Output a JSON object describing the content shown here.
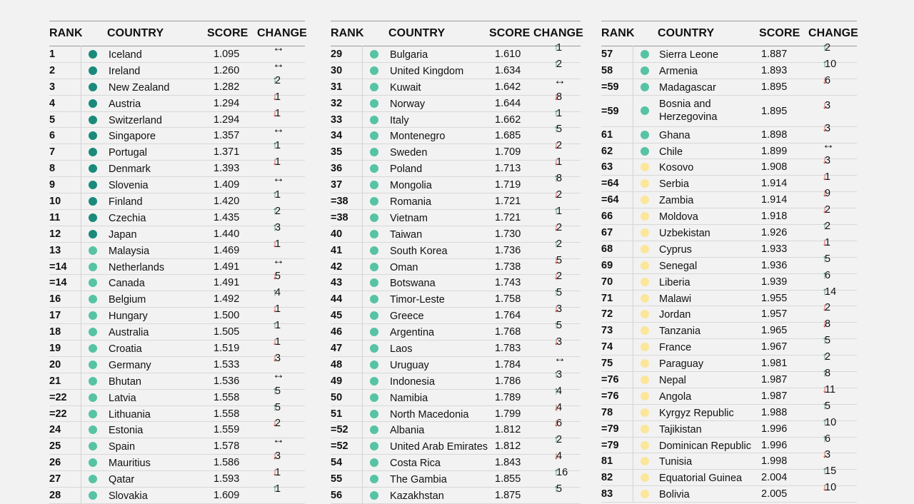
{
  "headers": {
    "rank": "RANK",
    "country": "COUNTRY",
    "score": "SCORE",
    "change": "CHANGE"
  },
  "colors": {
    "dark_teal": "#1a8a7a",
    "mid_teal": "#56c3a4",
    "light_yellow": "#fbe69a",
    "up": "#2e7d4f",
    "down": "#c62d1f"
  },
  "columns": [
    [
      {
        "rank": "1",
        "country": "Iceland",
        "score": "1.095",
        "dir": "flat",
        "change": "",
        "dot": "dark_teal"
      },
      {
        "rank": "2",
        "country": "Ireland",
        "score": "1.260",
        "dir": "flat",
        "change": "",
        "dot": "dark_teal"
      },
      {
        "rank": "3",
        "country": "New Zealand",
        "score": "1.282",
        "dir": "up",
        "change": "2",
        "dot": "dark_teal"
      },
      {
        "rank": "4",
        "country": "Austria",
        "score": "1.294",
        "dir": "down",
        "change": "1",
        "dot": "dark_teal"
      },
      {
        "rank": "5",
        "country": "Switzerland",
        "score": "1.294",
        "dir": "down",
        "change": "1",
        "dot": "dark_teal"
      },
      {
        "rank": "6",
        "country": "Singapore",
        "score": "1.357",
        "dir": "flat",
        "change": "",
        "dot": "dark_teal"
      },
      {
        "rank": "7",
        "country": "Portugal",
        "score": "1.371",
        "dir": "up",
        "change": "1",
        "dot": "dark_teal"
      },
      {
        "rank": "8",
        "country": "Denmark",
        "score": "1.393",
        "dir": "down",
        "change": "1",
        "dot": "dark_teal"
      },
      {
        "rank": "9",
        "country": "Slovenia",
        "score": "1.409",
        "dir": "flat",
        "change": "",
        "dot": "dark_teal"
      },
      {
        "rank": "10",
        "country": "Finland",
        "score": "1.420",
        "dir": "up",
        "change": "1",
        "dot": "dark_teal"
      },
      {
        "rank": "11",
        "country": "Czechia",
        "score": "1.435",
        "dir": "up",
        "change": "2",
        "dot": "dark_teal"
      },
      {
        "rank": "12",
        "country": "Japan",
        "score": "1.440",
        "dir": "up",
        "change": "3",
        "dot": "dark_teal"
      },
      {
        "rank": "13",
        "country": "Malaysia",
        "score": "1.469",
        "dir": "down",
        "change": "1",
        "dot": "mid_teal"
      },
      {
        "rank": "=14",
        "country": "Netherlands",
        "score": "1.491",
        "dir": "flat",
        "change": "",
        "dot": "mid_teal"
      },
      {
        "rank": "=14",
        "country": "Canada",
        "score": "1.491",
        "dir": "down",
        "change": "5",
        "dot": "mid_teal"
      },
      {
        "rank": "16",
        "country": "Belgium",
        "score": "1.492",
        "dir": "up",
        "change": "4",
        "dot": "mid_teal"
      },
      {
        "rank": "17",
        "country": "Hungary",
        "score": "1.500",
        "dir": "down",
        "change": "1",
        "dot": "mid_teal"
      },
      {
        "rank": "18",
        "country": "Australia",
        "score": "1.505",
        "dir": "up",
        "change": "1",
        "dot": "mid_teal"
      },
      {
        "rank": "19",
        "country": "Croatia",
        "score": "1.519",
        "dir": "down",
        "change": "1",
        "dot": "mid_teal"
      },
      {
        "rank": "20",
        "country": "Germany",
        "score": "1.533",
        "dir": "down",
        "change": "3",
        "dot": "mid_teal"
      },
      {
        "rank": "21",
        "country": "Bhutan",
        "score": "1.536",
        "dir": "flat",
        "change": "",
        "dot": "mid_teal"
      },
      {
        "rank": "=22",
        "country": "Latvia",
        "score": "1.558",
        "dir": "up",
        "change": "5",
        "dot": "mid_teal"
      },
      {
        "rank": "=22",
        "country": "Lithuania",
        "score": "1.558",
        "dir": "up",
        "change": "5",
        "dot": "mid_teal"
      },
      {
        "rank": "24",
        "country": "Estonia",
        "score": "1.559",
        "dir": "down",
        "change": "2",
        "dot": "mid_teal"
      },
      {
        "rank": "25",
        "country": "Spain",
        "score": "1.578",
        "dir": "flat",
        "change": "",
        "dot": "mid_teal"
      },
      {
        "rank": "26",
        "country": "Mauritius",
        "score": "1.586",
        "dir": "down",
        "change": "3",
        "dot": "mid_teal"
      },
      {
        "rank": "27",
        "country": "Qatar",
        "score": "1.593",
        "dir": "down",
        "change": "1",
        "dot": "mid_teal"
      },
      {
        "rank": "28",
        "country": "Slovakia",
        "score": "1.609",
        "dir": "up",
        "change": "1",
        "dot": "mid_teal"
      }
    ],
    [
      {
        "rank": "29",
        "country": "Bulgaria",
        "score": "1.610",
        "dir": "up",
        "change": "1",
        "dot": "mid_teal"
      },
      {
        "rank": "30",
        "country": "United Kingdom",
        "score": "1.634",
        "dir": "up",
        "change": "2",
        "dot": "mid_teal"
      },
      {
        "rank": "31",
        "country": "Kuwait",
        "score": "1.642",
        "dir": "flat",
        "change": "",
        "dot": "mid_teal"
      },
      {
        "rank": "32",
        "country": "Norway",
        "score": "1.644",
        "dir": "down",
        "change": "8",
        "dot": "mid_teal"
      },
      {
        "rank": "33",
        "country": "Italy",
        "score": "1.662",
        "dir": "up",
        "change": "1",
        "dot": "mid_teal"
      },
      {
        "rank": "34",
        "country": "Montenegro",
        "score": "1.685",
        "dir": "up",
        "change": "5",
        "dot": "mid_teal"
      },
      {
        "rank": "35",
        "country": "Sweden",
        "score": "1.709",
        "dir": "down",
        "change": "2",
        "dot": "mid_teal"
      },
      {
        "rank": "36",
        "country": "Poland",
        "score": "1.713",
        "dir": "down",
        "change": "1",
        "dot": "mid_teal"
      },
      {
        "rank": "37",
        "country": "Mongolia",
        "score": "1.719",
        "dir": "up",
        "change": "8",
        "dot": "mid_teal"
      },
      {
        "rank": "=38",
        "country": "Romania",
        "score": "1.721",
        "dir": "down",
        "change": "2",
        "dot": "mid_teal"
      },
      {
        "rank": "=38",
        "country": "Vietnam",
        "score": "1.721",
        "dir": "up",
        "change": "1",
        "dot": "mid_teal"
      },
      {
        "rank": "40",
        "country": "Taiwan",
        "score": "1.730",
        "dir": "down",
        "change": "2",
        "dot": "mid_teal"
      },
      {
        "rank": "41",
        "country": "South Korea",
        "score": "1.736",
        "dir": "up",
        "change": "2",
        "dot": "mid_teal"
      },
      {
        "rank": "42",
        "country": "Oman",
        "score": "1.738",
        "dir": "down",
        "change": "5",
        "dot": "mid_teal"
      },
      {
        "rank": "43",
        "country": "Botswana",
        "score": "1.743",
        "dir": "down",
        "change": "2",
        "dot": "mid_teal"
      },
      {
        "rank": "44",
        "country": "Timor-Leste",
        "score": "1.758",
        "dir": "up",
        "change": "5",
        "dot": "mid_teal"
      },
      {
        "rank": "45",
        "country": "Greece",
        "score": "1.764",
        "dir": "down",
        "change": "3",
        "dot": "mid_teal"
      },
      {
        "rank": "46",
        "country": "Argentina",
        "score": "1.768",
        "dir": "up",
        "change": "5",
        "dot": "mid_teal"
      },
      {
        "rank": "47",
        "country": "Laos",
        "score": "1.783",
        "dir": "down",
        "change": "3",
        "dot": "mid_teal"
      },
      {
        "rank": "48",
        "country": "Uruguay",
        "score": "1.784",
        "dir": "flat",
        "change": "",
        "dot": "mid_teal"
      },
      {
        "rank": "49",
        "country": "Indonesia",
        "score": "1.786",
        "dir": "up",
        "change": "3",
        "dot": "mid_teal"
      },
      {
        "rank": "50",
        "country": "Namibia",
        "score": "1.789",
        "dir": "up",
        "change": "4",
        "dot": "mid_teal"
      },
      {
        "rank": "51",
        "country": "North Macedonia",
        "score": "1.799",
        "dir": "down",
        "change": "4",
        "dot": "mid_teal"
      },
      {
        "rank": "=52",
        "country": "Albania",
        "score": "1.812",
        "dir": "down",
        "change": "6",
        "dot": "mid_teal"
      },
      {
        "rank": "=52",
        "country": "United Arab Emirates",
        "score": "1.812",
        "dir": "up",
        "change": "2",
        "dot": "mid_teal"
      },
      {
        "rank": "54",
        "country": "Costa Rica",
        "score": "1.843",
        "dir": "down",
        "change": "4",
        "dot": "mid_teal"
      },
      {
        "rank": "55",
        "country": "The Gambia",
        "score": "1.855",
        "dir": "up",
        "change": "16",
        "dot": "mid_teal"
      },
      {
        "rank": "56",
        "country": "Kazakhstan",
        "score": "1.875",
        "dir": "up",
        "change": "5",
        "dot": "mid_teal"
      }
    ],
    [
      {
        "rank": "57",
        "country": "Sierra Leone",
        "score": "1.887",
        "dir": "up",
        "change": "2",
        "dot": "mid_teal"
      },
      {
        "rank": "58",
        "country": "Armenia",
        "score": "1.893",
        "dir": "up",
        "change": "10",
        "dot": "mid_teal"
      },
      {
        "rank": "=59",
        "country": "Madagascar",
        "score": "1.895",
        "dir": "down",
        "change": "6",
        "dot": "mid_teal"
      },
      {
        "rank": "=59",
        "country": "Bosnia and Herzegovina",
        "score": "1.895",
        "dir": "down",
        "change": "3",
        "dot": "mid_teal",
        "tall": true
      },
      {
        "rank": "61",
        "country": "Ghana",
        "score": "1.898",
        "dir": "down",
        "change": "3",
        "dot": "mid_teal"
      },
      {
        "rank": "62",
        "country": "Chile",
        "score": "1.899",
        "dir": "flat",
        "change": "",
        "dot": "mid_teal"
      },
      {
        "rank": "63",
        "country": "Kosovo",
        "score": "1.908",
        "dir": "down",
        "change": "3",
        "dot": "light_yellow"
      },
      {
        "rank": "=64",
        "country": "Serbia",
        "score": "1.914",
        "dir": "down",
        "change": "1",
        "dot": "light_yellow"
      },
      {
        "rank": "=64",
        "country": "Zambia",
        "score": "1.914",
        "dir": "down",
        "change": "9",
        "dot": "light_yellow"
      },
      {
        "rank": "66",
        "country": "Moldova",
        "score": "1.918",
        "dir": "down",
        "change": "2",
        "dot": "light_yellow"
      },
      {
        "rank": "67",
        "country": "Uzbekistan",
        "score": "1.926",
        "dir": "up",
        "change": "2",
        "dot": "light_yellow"
      },
      {
        "rank": "68",
        "country": "Cyprus",
        "score": "1.933",
        "dir": "down",
        "change": "1",
        "dot": "light_yellow"
      },
      {
        "rank": "69",
        "country": "Senegal",
        "score": "1.936",
        "dir": "up",
        "change": "5",
        "dot": "light_yellow"
      },
      {
        "rank": "70",
        "country": "Liberia",
        "score": "1.939",
        "dir": "up",
        "change": "6",
        "dot": "light_yellow"
      },
      {
        "rank": "71",
        "country": "Malawi",
        "score": "1.955",
        "dir": "up",
        "change": "14",
        "dot": "light_yellow"
      },
      {
        "rank": "72",
        "country": "Jordan",
        "score": "1.957",
        "dir": "down",
        "change": "2",
        "dot": "light_yellow"
      },
      {
        "rank": "73",
        "country": "Tanzania",
        "score": "1.965",
        "dir": "down",
        "change": "8",
        "dot": "light_yellow"
      },
      {
        "rank": "74",
        "country": "France",
        "score": "1.967",
        "dir": "up",
        "change": "5",
        "dot": "light_yellow"
      },
      {
        "rank": "75",
        "country": "Paraguay",
        "score": "1.981",
        "dir": "up",
        "change": "2",
        "dot": "light_yellow"
      },
      {
        "rank": "=76",
        "country": "Nepal",
        "score": "1.987",
        "dir": "up",
        "change": "8",
        "dot": "light_yellow"
      },
      {
        "rank": "=76",
        "country": "Angola",
        "score": "1.987",
        "dir": "down",
        "change": "11",
        "dot": "light_yellow"
      },
      {
        "rank": "78",
        "country": "Kyrgyz Republic",
        "score": "1.988",
        "dir": "up",
        "change": "5",
        "dot": "light_yellow"
      },
      {
        "rank": "=79",
        "country": "Tajikistan",
        "score": "1.996",
        "dir": "up",
        "change": "10",
        "dot": "light_yellow"
      },
      {
        "rank": "=79",
        "country": "Dominican Republic",
        "score": "1.996",
        "dir": "up",
        "change": "6",
        "dot": "light_yellow"
      },
      {
        "rank": "81",
        "country": "Tunisia",
        "score": "1.998",
        "dir": "down",
        "change": "3",
        "dot": "light_yellow"
      },
      {
        "rank": "82",
        "country": "Equatorial Guinea",
        "score": "2.004",
        "dir": "up",
        "change": "15",
        "dot": "light_yellow"
      },
      {
        "rank": "83",
        "country": "Bolivia",
        "score": "2.005",
        "dir": "down",
        "change": "10",
        "dot": "light_yellow"
      }
    ]
  ]
}
